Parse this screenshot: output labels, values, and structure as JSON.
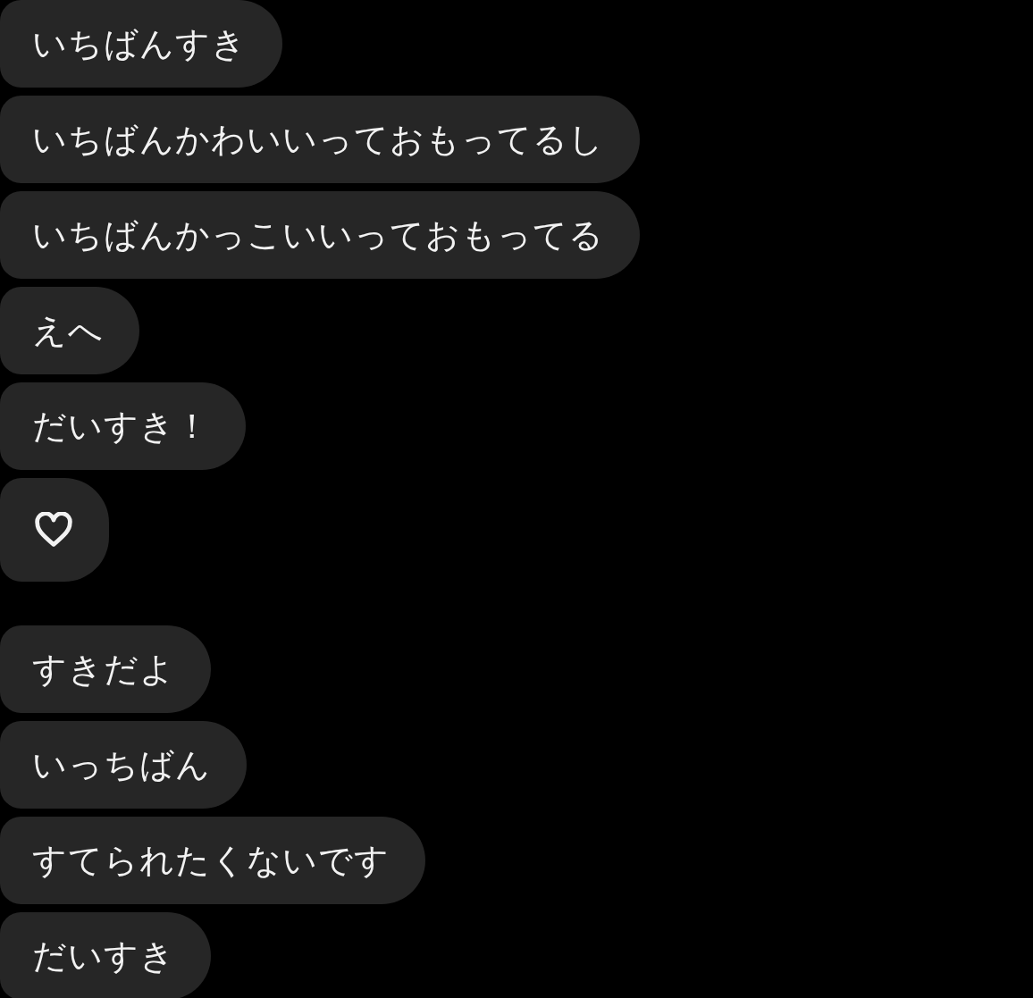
{
  "groups": [
    {
      "messages": [
        {
          "kind": "text",
          "text": "いちばんすき"
        },
        {
          "kind": "text",
          "text": "いちばんかわいいっておもってるし"
        },
        {
          "kind": "text",
          "text": "いちばんかっこいいっておもってる"
        },
        {
          "kind": "text",
          "text": "えへ"
        },
        {
          "kind": "text",
          "text": "だいすき！"
        },
        {
          "kind": "heart"
        }
      ]
    },
    {
      "messages": [
        {
          "kind": "text",
          "text": "すきだよ"
        },
        {
          "kind": "text",
          "text": "いっちばん"
        },
        {
          "kind": "text",
          "text": "すてられたくないです"
        },
        {
          "kind": "text",
          "text": "だいすき"
        }
      ]
    }
  ]
}
